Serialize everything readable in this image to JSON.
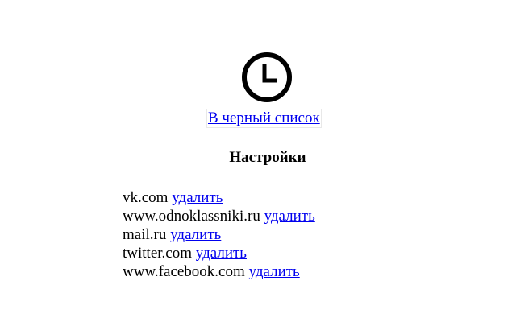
{
  "header": {
    "icon": "clock-icon",
    "blacklist_link": "В черный список"
  },
  "settings": {
    "title": "Настройки",
    "delete_label": "удалить",
    "sites": [
      "vk.com",
      "www.odnoklassniki.ru",
      "mail.ru",
      "twitter.com",
      "www.facebook.com"
    ]
  },
  "colors": {
    "link": "#0000ee",
    "text": "#000000",
    "background": "#ffffff"
  }
}
